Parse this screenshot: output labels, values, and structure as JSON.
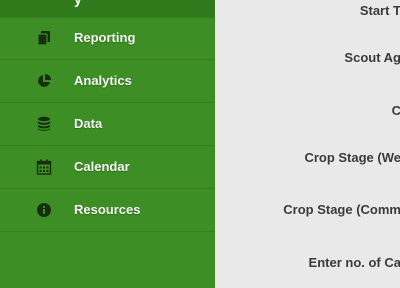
{
  "sidebar": {
    "top_partial_label": "y",
    "items": [
      {
        "label": "Reporting",
        "icon": "copy-icon"
      },
      {
        "label": "Analytics",
        "icon": "pie-chart-icon"
      },
      {
        "label": "Data",
        "icon": "database-icon"
      },
      {
        "label": "Calendar",
        "icon": "calendar-icon"
      },
      {
        "label": "Resources",
        "icon": "info-icon"
      }
    ]
  },
  "form": {
    "labels": [
      "Start T",
      "Scout Ag",
      "C",
      "Crop Stage (We",
      "Crop Stage (Comm",
      "Enter no. of Ca"
    ]
  },
  "colors": {
    "sidebar_bg": "#3e8e26",
    "sidebar_border": "#357f1f",
    "content_bg": "#e9e9e9",
    "label_text": "#3a3a3a",
    "nav_text": "#f4f4f4"
  }
}
